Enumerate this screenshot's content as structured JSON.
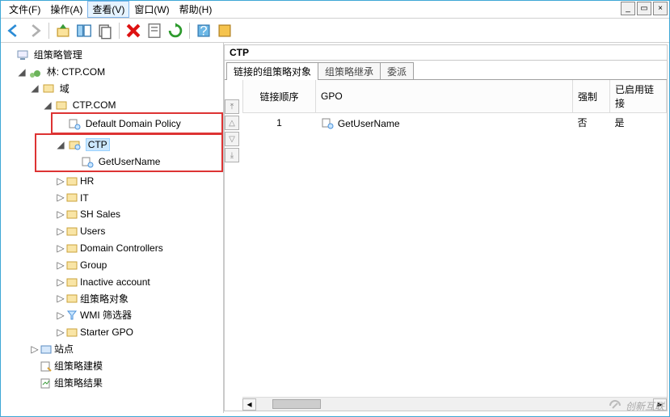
{
  "window_controls": {
    "min": "_",
    "max": "▭",
    "close": "×"
  },
  "menu": {
    "file": "文件(F)",
    "action": "操作(A)",
    "view": "查看(V)",
    "window": "窗口(W)",
    "help": "帮助(H)"
  },
  "tree": {
    "root": "组策略管理",
    "forest": "林: CTP.COM",
    "domains": "域",
    "domain": "CTP.COM",
    "defaultPolicy": "Default Domain Policy",
    "ctp": "CTP",
    "getUserName": "GetUserName",
    "hr": "HR",
    "it": "IT",
    "shsales": "SH Sales",
    "users": "Users",
    "dc": "Domain Controllers",
    "group": "Group",
    "inactive": "Inactive account",
    "gpo_obj": "组策略对象",
    "wmi": "WMI 筛选器",
    "starter": "Starter GPO",
    "sites": "站点",
    "modeling": "组策略建模",
    "results": "组策略结果"
  },
  "right": {
    "title": "CTP",
    "tabs": {
      "linked": "链接的组策略对象",
      "inherit": "组策略继承",
      "delegate": "委派"
    },
    "columns": {
      "order": "链接顺序",
      "gpo": "GPO",
      "enforced": "强制",
      "enabled": "已启用链接"
    },
    "rows": [
      {
        "order": "1",
        "gpo": "GetUserName",
        "enforced": "否",
        "enabled": "是"
      }
    ]
  },
  "watermark": "创新互联"
}
